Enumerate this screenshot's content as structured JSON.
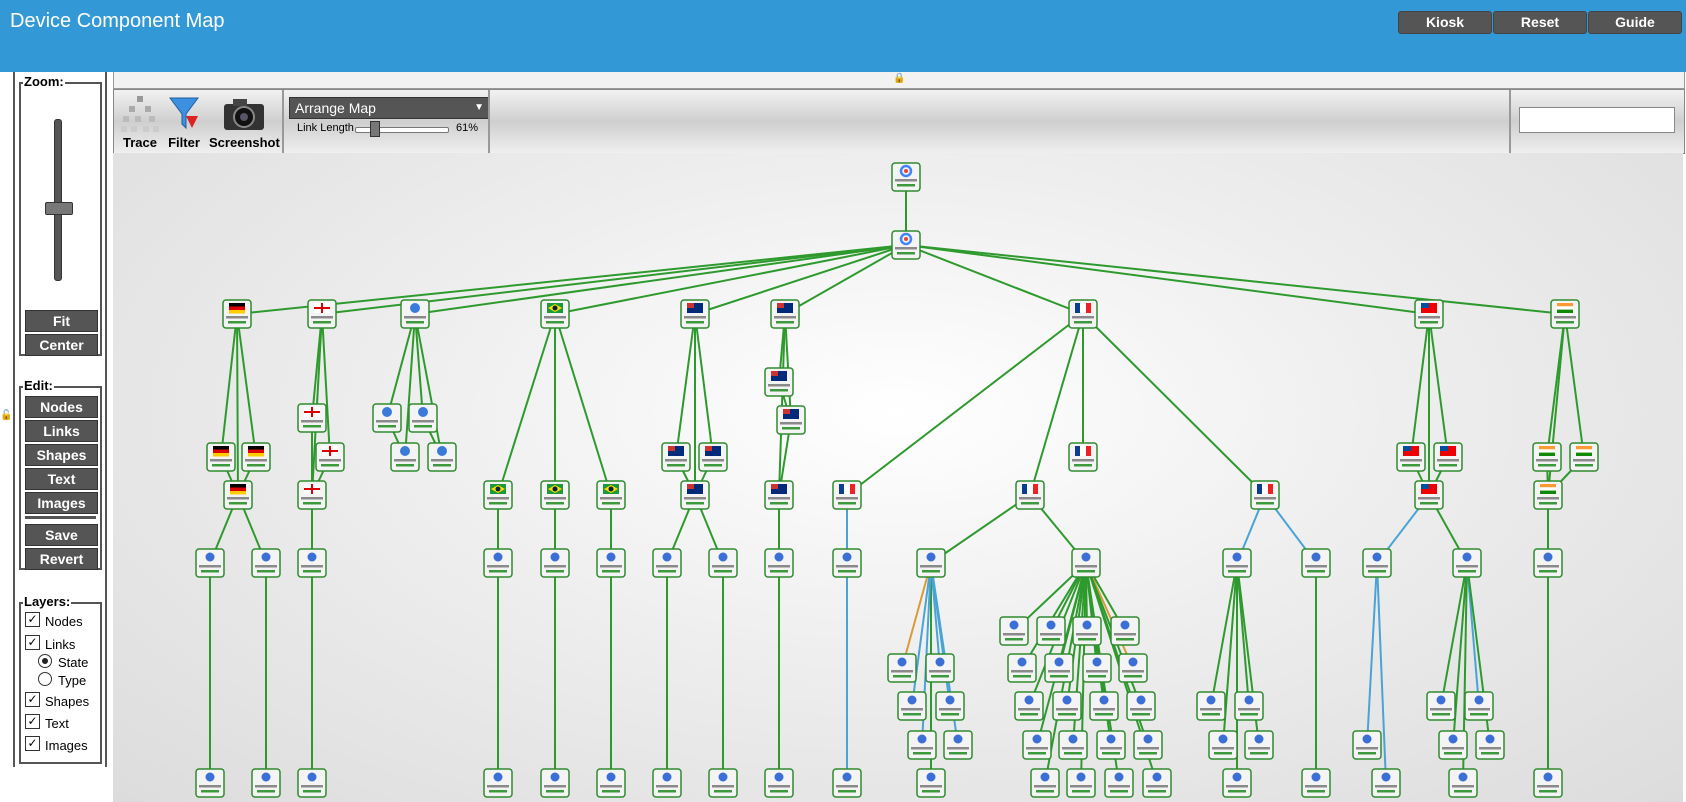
{
  "app": {
    "title": "Device Component Map"
  },
  "header_buttons": [
    "Kiosk",
    "Reset",
    "Guide"
  ],
  "zoom": {
    "label": "Zoom:",
    "fit": "Fit",
    "center": "Center"
  },
  "edit": {
    "label": "Edit:",
    "buttons": [
      "Nodes",
      "Links",
      "Shapes",
      "Text",
      "Images"
    ],
    "save": "Save",
    "revert": "Revert"
  },
  "layers": {
    "label": "Layers:",
    "items": [
      {
        "label": "Nodes",
        "checked": true
      },
      {
        "label": "Links",
        "checked": true
      },
      {
        "label": "Shapes",
        "checked": true
      },
      {
        "label": "Text",
        "checked": true
      },
      {
        "label": "Images",
        "checked": true
      }
    ],
    "link_modes": [
      {
        "label": "State",
        "selected": true
      },
      {
        "label": "Type",
        "selected": false
      }
    ]
  },
  "toolbar": {
    "trace": "Trace",
    "filter": "Filter",
    "screenshot": "Screenshot",
    "arrange_select": "Arrange Map",
    "link_length_label": "Link Length",
    "link_length_value": "61%",
    "search_value": ""
  },
  "colors": {
    "header": "#3399d6",
    "link_ok": "#2e9a2e",
    "link_blue": "#4aa3d6",
    "link_orange": "#d99a3a"
  }
}
